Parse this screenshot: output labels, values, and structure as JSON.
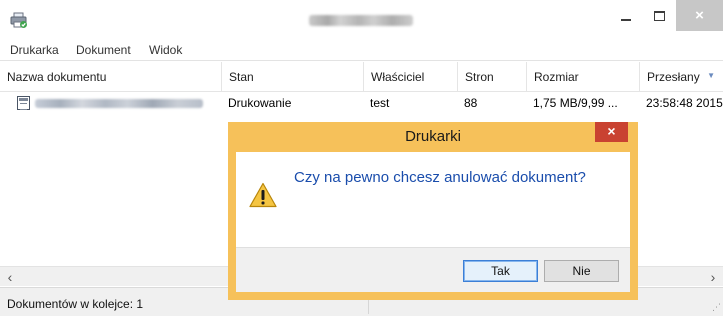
{
  "window": {
    "title_icon": "printer-icon",
    "controls": {
      "minimize_icon": "minimize-icon",
      "maximize_icon": "maximize-icon",
      "close_symbol": "×"
    }
  },
  "menu": {
    "items": [
      {
        "label": "Drukarka"
      },
      {
        "label": "Dokument"
      },
      {
        "label": "Widok"
      }
    ]
  },
  "table": {
    "columns": [
      {
        "label": "Nazwa dokumentu"
      },
      {
        "label": "Stan"
      },
      {
        "label": "Właściciel"
      },
      {
        "label": "Stron"
      },
      {
        "label": "Rozmiar"
      },
      {
        "label": "Przesłany"
      }
    ],
    "rows": [
      {
        "status": "Drukowanie",
        "owner": "test",
        "pages": "88",
        "size": "1,75 MB/9,99 ...",
        "submitted": "23:58:48 2015"
      }
    ]
  },
  "scrollbar": {
    "left": "‹",
    "right": "›"
  },
  "statusbar": {
    "queue_text": "Dokumentów w kolejce: 1"
  },
  "dialog": {
    "title": "Drukarki",
    "close_symbol": "×",
    "icon": "warning-icon",
    "message": "Czy na pewno chcesz anulować dokument?",
    "buttons": {
      "yes": "Tak",
      "no": "Nie"
    }
  },
  "colors": {
    "dialog_frame": "#f6c15a",
    "dialog_close": "#c94231",
    "dialog_message": "#1a4dac",
    "default_button_border": "#3c7fd6"
  }
}
